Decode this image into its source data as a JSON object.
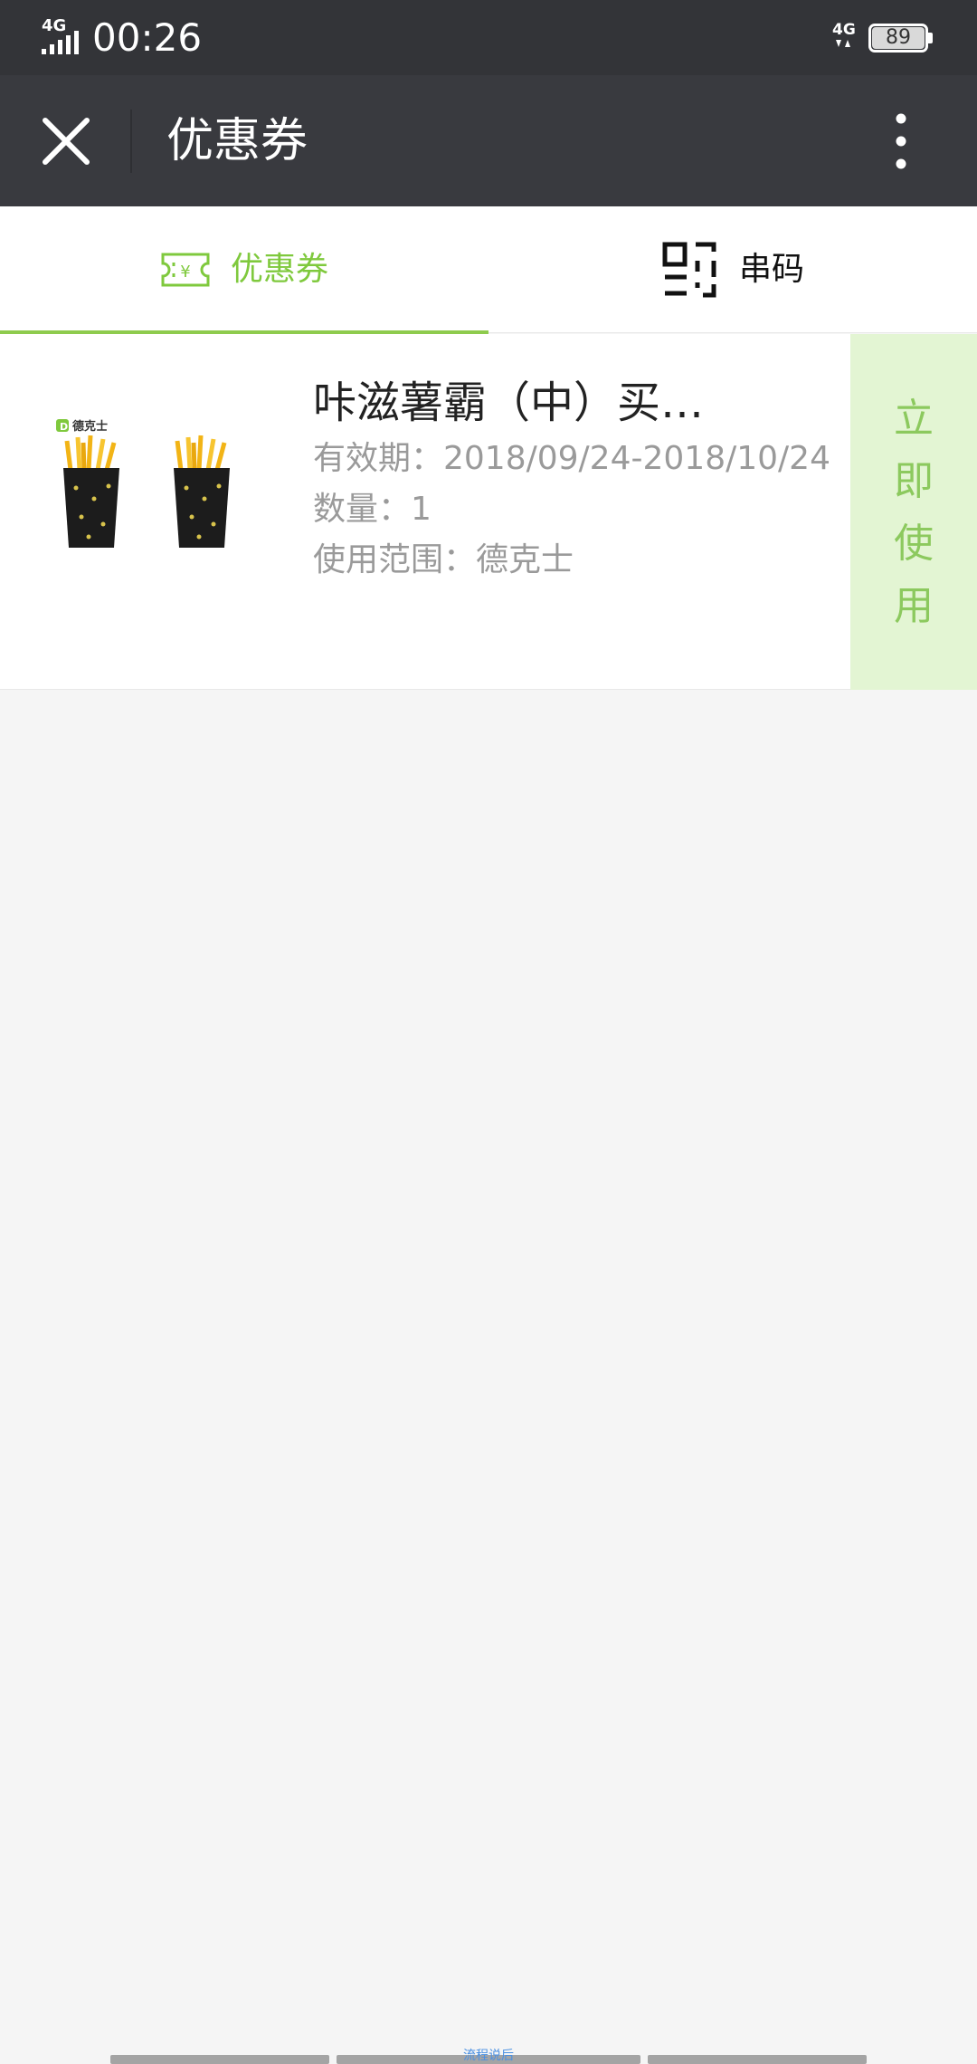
{
  "status_bar": {
    "time": "00:26",
    "battery": "89",
    "signal_label": "4G",
    "network_label": "4G"
  },
  "title_bar": {
    "title": "优惠券"
  },
  "tabs": [
    {
      "label": "优惠券",
      "active": true
    },
    {
      "label": "串码",
      "active": false
    }
  ],
  "coupon": {
    "name": "咔滋薯霸（中）买…",
    "validity": "有效期：2018/09/24-2018/10/24",
    "quantity": "数量：1",
    "scope": "使用范围：德克士",
    "brand": "德克士",
    "use_button": "立即使用"
  },
  "bottom": {
    "hint": "流程说后"
  },
  "colors": {
    "accent_green": "#7fc93d",
    "use_bg": "#e3f5d3",
    "header_bg": "#393a3f"
  }
}
